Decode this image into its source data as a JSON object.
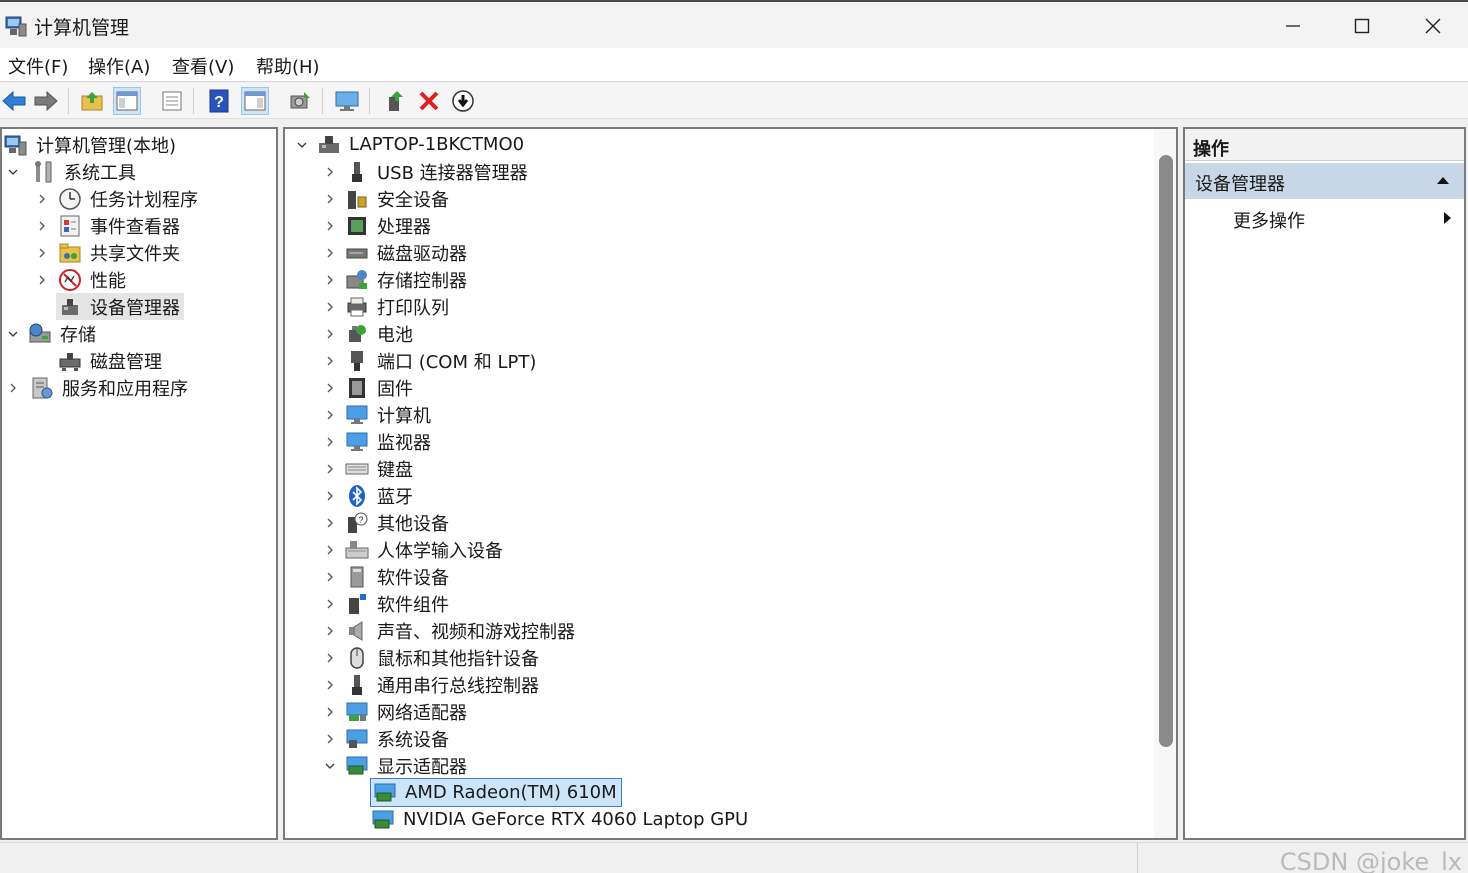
{
  "window": {
    "title": "计算机管理",
    "controls": {
      "minimize": "—",
      "maximize": "☐",
      "close": "✕"
    }
  },
  "menu": [
    "文件(F)",
    "操作(A)",
    "查看(V)",
    "帮助(H)"
  ],
  "toolbar": {
    "icons": [
      "back-icon",
      "forward-icon",
      "up-folder-icon",
      "show-tree-icon",
      "properties-icon",
      "help-icon",
      "show-action-pane-icon",
      "scan-hardware-icon",
      "monitor-icon",
      "update-driver-icon",
      "uninstall-icon",
      "disable-device-icon"
    ]
  },
  "left_tree": [
    {
      "label": "计算机管理(本地)",
      "icon": "computer-management-icon",
      "level": 0,
      "expander": ""
    },
    {
      "label": "系统工具",
      "icon": "system-tools-icon",
      "level": 1,
      "expander": "expanded"
    },
    {
      "label": "任务计划程序",
      "icon": "task-scheduler-icon",
      "level": 2,
      "expander": "collapsed"
    },
    {
      "label": "事件查看器",
      "icon": "event-viewer-icon",
      "level": 2,
      "expander": "collapsed"
    },
    {
      "label": "共享文件夹",
      "icon": "shared-folders-icon",
      "level": 2,
      "expander": "collapsed"
    },
    {
      "label": "性能",
      "icon": "performance-icon",
      "level": 2,
      "expander": "collapsed"
    },
    {
      "label": "设备管理器",
      "icon": "device-manager-icon",
      "level": 2,
      "expander": "",
      "selected": true
    },
    {
      "label": "存储",
      "icon": "storage-icon",
      "level": 1,
      "expander": "expanded"
    },
    {
      "label": "磁盘管理",
      "icon": "disk-management-icon",
      "level": 2,
      "expander": ""
    },
    {
      "label": "服务和应用程序",
      "icon": "services-apps-icon",
      "level": 1,
      "expander": "collapsed"
    }
  ],
  "device_tree": {
    "root": "LAPTOP-1BKCTMO0",
    "categories": [
      {
        "label": "USB 连接器管理器",
        "icon": "usb-connector-icon"
      },
      {
        "label": "安全设备",
        "icon": "security-device-icon"
      },
      {
        "label": "处理器",
        "icon": "processor-icon"
      },
      {
        "label": "磁盘驱动器",
        "icon": "disk-drive-icon"
      },
      {
        "label": "存储控制器",
        "icon": "storage-controller-icon"
      },
      {
        "label": "打印队列",
        "icon": "print-queue-icon"
      },
      {
        "label": "电池",
        "icon": "battery-icon"
      },
      {
        "label": "端口 (COM 和 LPT)",
        "icon": "port-icon"
      },
      {
        "label": "固件",
        "icon": "firmware-icon"
      },
      {
        "label": "计算机",
        "icon": "computer-icon"
      },
      {
        "label": "监视器",
        "icon": "monitor-icon"
      },
      {
        "label": "键盘",
        "icon": "keyboard-icon"
      },
      {
        "label": "蓝牙",
        "icon": "bluetooth-icon"
      },
      {
        "label": "其他设备",
        "icon": "other-devices-icon"
      },
      {
        "label": "人体学输入设备",
        "icon": "hid-icon"
      },
      {
        "label": "软件设备",
        "icon": "software-device-icon"
      },
      {
        "label": "软件组件",
        "icon": "software-component-icon"
      },
      {
        "label": "声音、视频和游戏控制器",
        "icon": "sound-icon"
      },
      {
        "label": "鼠标和其他指针设备",
        "icon": "mouse-icon"
      },
      {
        "label": "通用串行总线控制器",
        "icon": "usb-controller-icon"
      },
      {
        "label": "网络适配器",
        "icon": "network-adapter-icon"
      },
      {
        "label": "系统设备",
        "icon": "system-device-icon"
      },
      {
        "label": "显示适配器",
        "icon": "display-adapter-icon",
        "expanded": true,
        "children": [
          {
            "label": "AMD Radeon(TM) 610M",
            "icon": "display-adapter-icon",
            "selected": true
          },
          {
            "label": "NVIDIA GeForce RTX 4060 Laptop GPU",
            "icon": "display-adapter-icon"
          }
        ]
      }
    ]
  },
  "actions": {
    "header": "操作",
    "group": "设备管理器",
    "item": "更多操作"
  },
  "watermark": "CSDN @joke_lx",
  "colors": {
    "selection": "#cce4f7",
    "selection_border": "#3d7ad4",
    "action_group": "#c8d7e8",
    "uninstall_red": "#e0201c"
  }
}
